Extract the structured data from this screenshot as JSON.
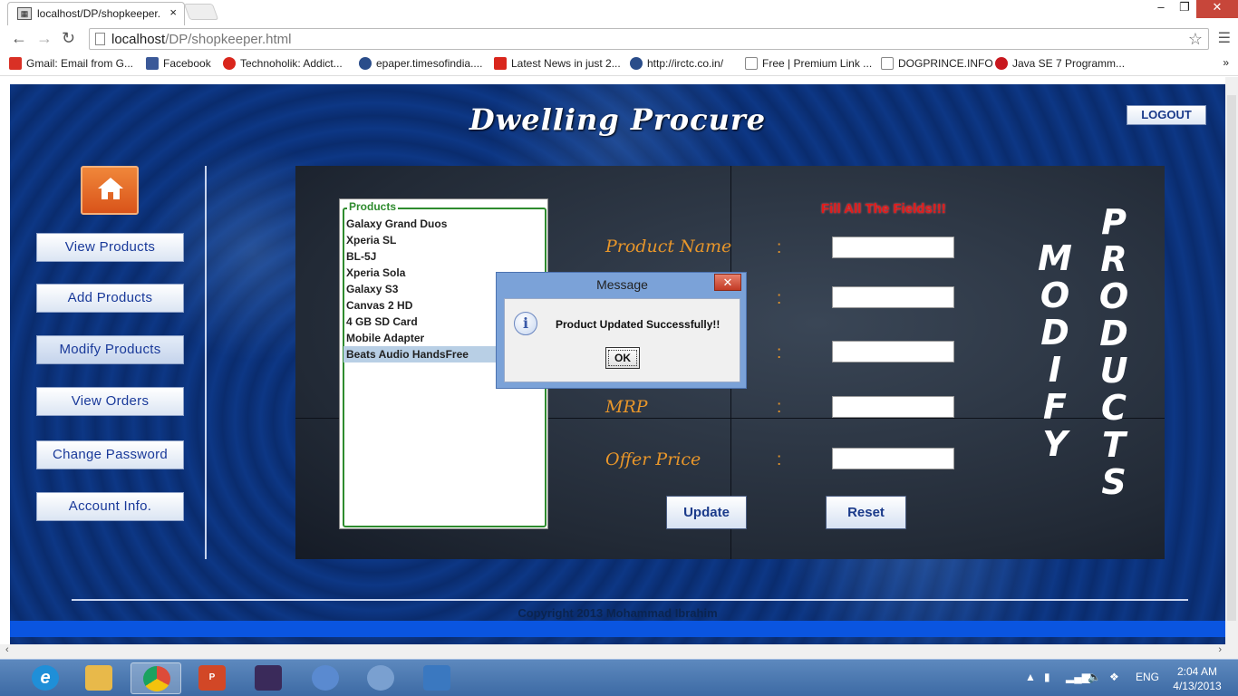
{
  "browser": {
    "tab_title": "localhost/DP/shopkeeper.",
    "tab_close": "×",
    "url_host": "localhost",
    "url_path": "/DP/shopkeeper.html",
    "window_controls": {
      "minimize": "–",
      "restore": "❐",
      "close": "✕"
    },
    "bookmarks": [
      {
        "label": "Gmail: Email from G...",
        "color": "#d93025"
      },
      {
        "label": "Facebook",
        "color": "#3b5998"
      },
      {
        "label": "Technoholik: Addict...",
        "color": "#d9261c"
      },
      {
        "label": "epaper.timesofindia....",
        "color": "#2a4d8a"
      },
      {
        "label": "Latest News in just 2...",
        "color": "#d9261c"
      },
      {
        "label": "http://irctc.co.in/",
        "color": "#2a4d8a"
      },
      {
        "label": "Free | Premium Link ...",
        "color": "#ffffff"
      },
      {
        "label": "DOGPRINCE.INFO",
        "color": "#ffffff"
      },
      {
        "label": "Java SE 7 Programm...",
        "color": "#c8171e"
      }
    ],
    "bookmarks_more": "»"
  },
  "site": {
    "title": "Dwelling Procure",
    "logout": "LOGOUT",
    "nav": [
      "View Products",
      "Add Products",
      "Modify Products",
      "View Orders",
      "Change Password",
      "Account Info."
    ],
    "active_nav": "Modify Products",
    "copyright": "Copyright 2013 Mohammad Ibrahim"
  },
  "applet": {
    "list_legend": "Products",
    "products": [
      "Galaxy Grand Duos",
      "Xperia SL",
      "BL-5J",
      "Xperia Sola",
      "Galaxy S3",
      "Canvas 2 HD",
      "4 GB SD Card",
      "Mobile Adapter",
      "Beats Audio HandsFree"
    ],
    "selected_product": "Beats Audio HandsFree",
    "warning": "Fill All The Fields!!!",
    "fields": {
      "product_name": "Product Name",
      "mrp": "MRP",
      "offer_price": "Offer Price",
      "colon": ":"
    },
    "update_button": "Update",
    "reset_button": "Reset",
    "side_word_1": [
      "M",
      "O",
      "D",
      "I",
      "F",
      "Y"
    ],
    "side_word_2": [
      "P",
      "R",
      "O",
      "D",
      "U",
      "C",
      "T",
      "S"
    ]
  },
  "dialog": {
    "title": "Message",
    "close": "✕",
    "icon": "i",
    "message": "Product Updated Successfully!!",
    "ok": "OK"
  },
  "taskbar": {
    "apps": [
      {
        "name": "internet-explorer",
        "color": "#1f8fd8"
      },
      {
        "name": "file-explorer",
        "color": "#e8b94a"
      },
      {
        "name": "chrome",
        "color": "#dd4b39"
      },
      {
        "name": "powerpoint",
        "color": "#d24726"
      },
      {
        "name": "java-ee-ide",
        "color": "#3a2a5a"
      },
      {
        "name": "installer",
        "color": "#5a8ad0"
      },
      {
        "name": "paint",
        "color": "#7aa0d0"
      },
      {
        "name": "picture-viewer",
        "color": "#3a78c0"
      }
    ],
    "language": "ENG",
    "time": "2:04 AM",
    "date": "4/13/2013"
  }
}
